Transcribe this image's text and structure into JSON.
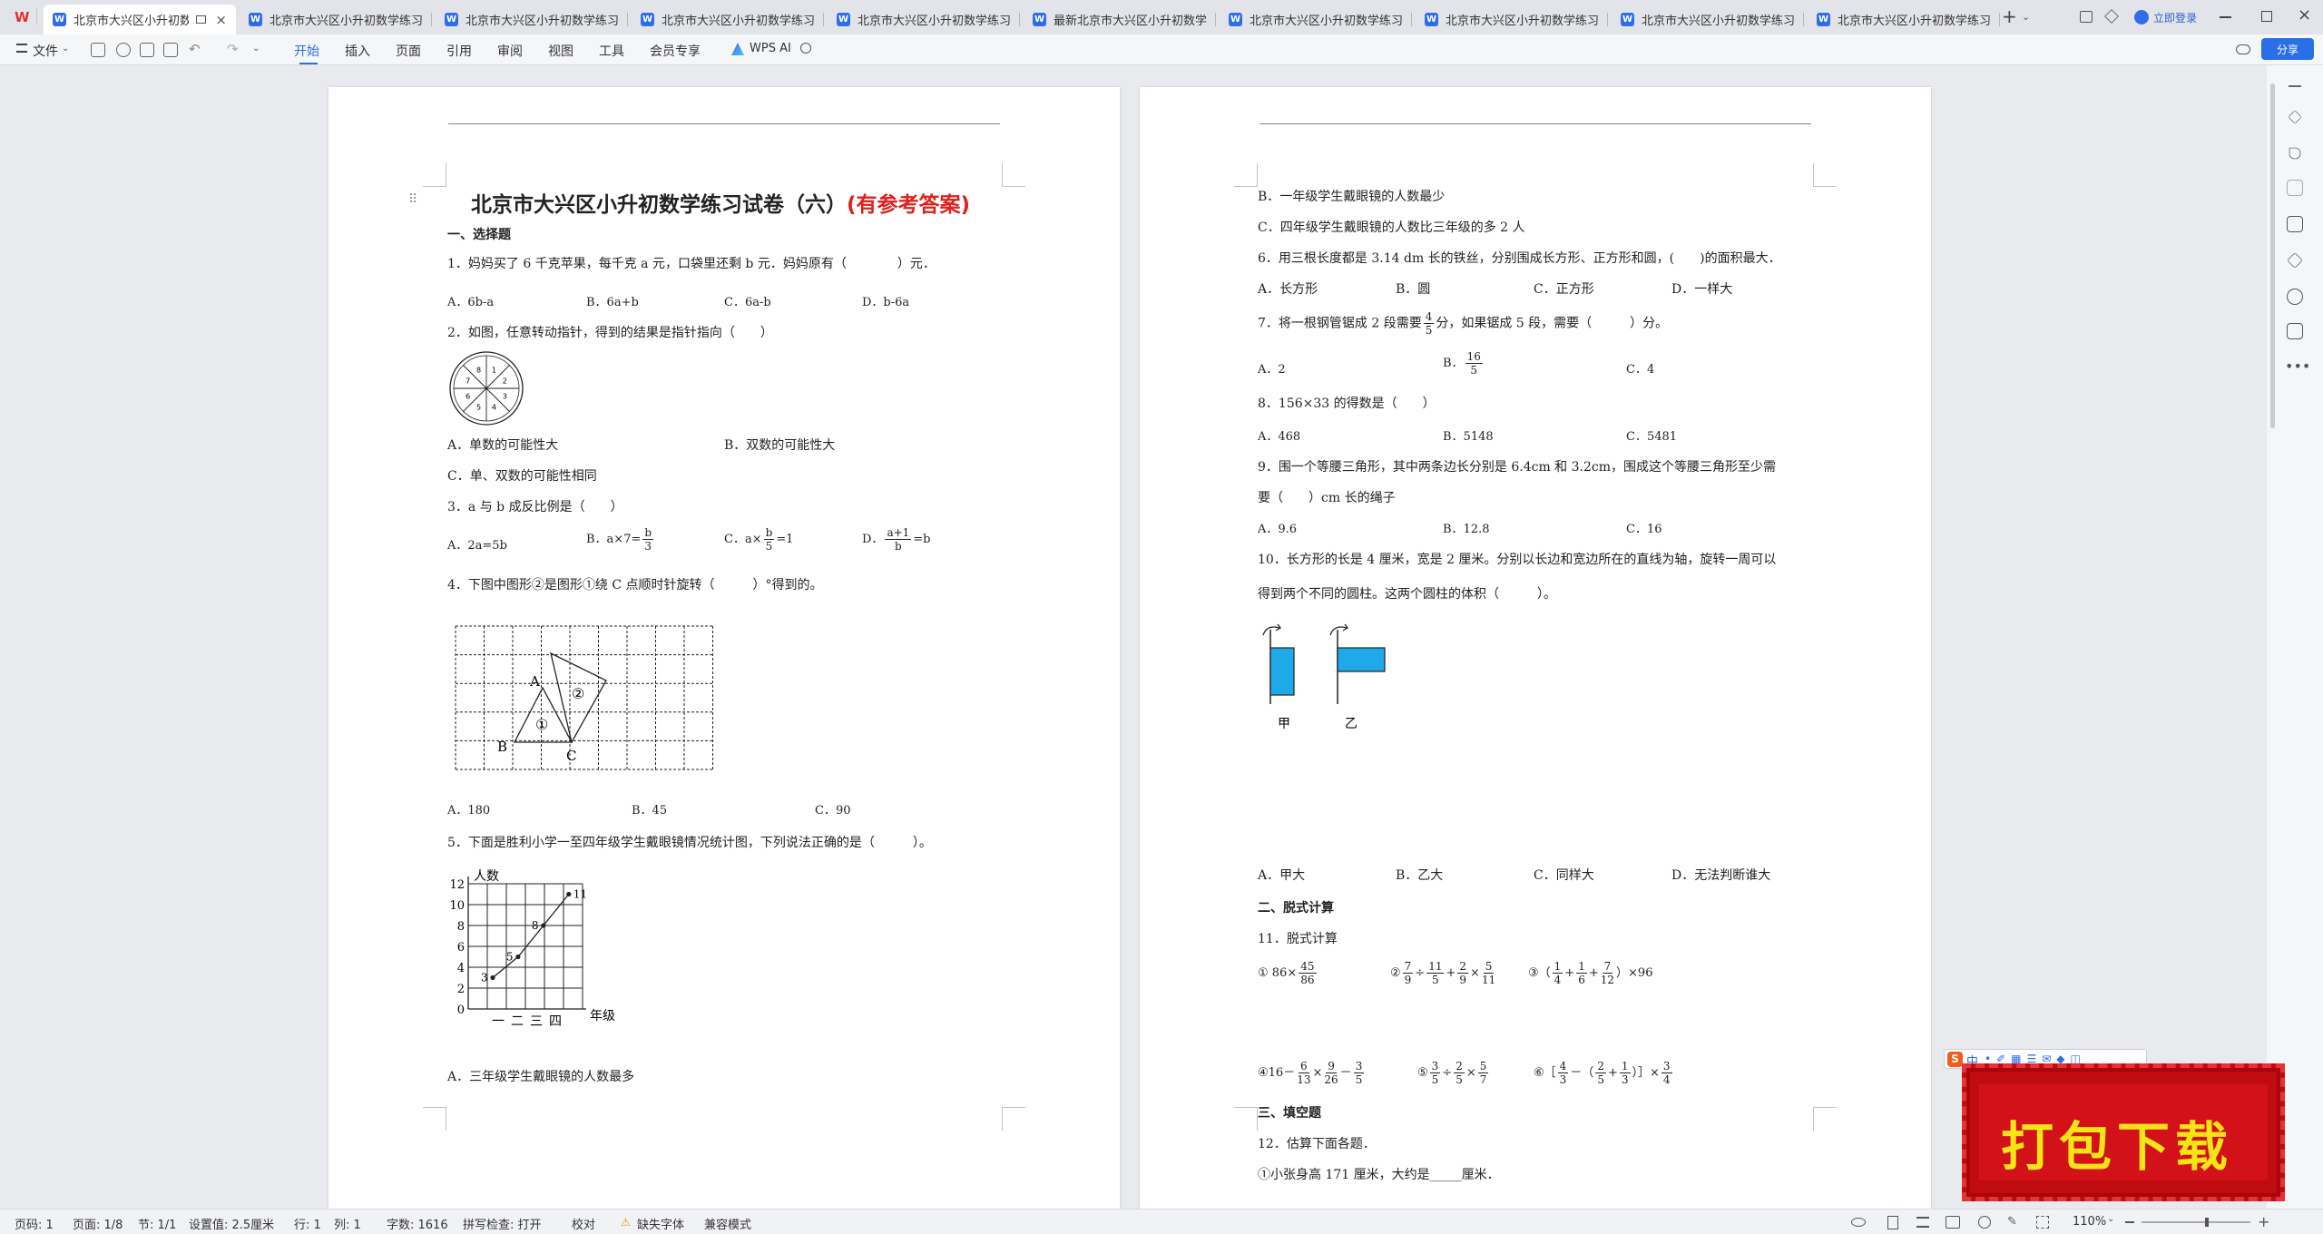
{
  "tabs": [
    {
      "label": "北京市大兴区小升初数学"
    },
    {
      "label": "北京市大兴区小升初数学练习试"
    },
    {
      "label": "北京市大兴区小升初数学练习试"
    },
    {
      "label": "北京市大兴区小升初数学练习试"
    },
    {
      "label": "北京市大兴区小升初数学练习试"
    },
    {
      "label": "最新北京市大兴区小升初数学练"
    },
    {
      "label": "北京市大兴区小升初数学练习试"
    },
    {
      "label": "北京市大兴区小升初数学练习试"
    },
    {
      "label": "北京市大兴区小升初数学练习试"
    },
    {
      "label": "北京市大兴区小升初数学练习试"
    }
  ],
  "header": {
    "login": "立即登录",
    "share": "分享"
  },
  "toolbar": {
    "file": "文件",
    "menus": [
      "开始",
      "插入",
      "页面",
      "引用",
      "审阅",
      "视图",
      "工具",
      "会员专享"
    ],
    "wps_ai": "WPS AI"
  },
  "doc": {
    "title_main": "北京市大兴区小升初数学练习试卷（六）",
    "title_red": "(有参考答案)",
    "sec1": "一、选择题",
    "q1": "1．妈妈买了 6 千克苹果，每千克 a 元，口袋里还剩 b 元．妈妈原有（　　　　）元．",
    "q1_opts": [
      "A．6b-a",
      "B．6a+b",
      "C．6a-b",
      "D．b-6a"
    ],
    "q2": "2．如图，任意转动指针，得到的结果是指针指向（　　）",
    "q2_opts": [
      "A．单数的可能性大",
      "B．双数的可能性大",
      "C．单、双数的可能性相同"
    ],
    "spinner_nums": [
      "8",
      "1",
      "2",
      "3",
      "4",
      "5",
      "6",
      "7"
    ],
    "q3": "3．a 与 b 成反比例是（　　）",
    "q3_a": "A．2a=5b",
    "q3_b_pre": "B．a×7=",
    "q3_b_frac": [
      "b",
      "3"
    ],
    "q3_c_pre": "C．a×",
    "q3_c_frac": [
      "b",
      "5"
    ],
    "q3_c_post": "=1",
    "q3_d_pre": "D．",
    "q3_d_frac": [
      "a+1",
      "b"
    ],
    "q3_d_post": "=b",
    "q4": "4．下图中图形②是图形①绕 C 点顺时针旋转（　　　）°得到的。",
    "q4_labels": [
      "A",
      "B",
      "C",
      "①",
      "②"
    ],
    "q4_opts": [
      "A．180",
      "B．45",
      "C．90"
    ],
    "q5": "5．下面是胜利小学一至四年级学生戴眼镜情况统计图，下列说法正确的是（　　　）。",
    "chart_ylabel": "人数",
    "chart_xlabel": "年级",
    "chart_y_ticks": [
      "12",
      "10",
      "8",
      "6",
      "4",
      "2",
      "0"
    ],
    "chart_x_ticks": [
      "一",
      "二",
      "三",
      "四"
    ],
    "chart_point_labels": [
      "3",
      "5",
      "8",
      "11"
    ],
    "q5_a": "A．三年级学生戴眼镜的人数最多",
    "q5_b": "B．一年级学生戴眼镜的人数最少",
    "q5_c": "C．四年级学生戴眼镜的人数比三年级的多 2 人",
    "q6": "6．用三根长度都是 3.14 dm 长的铁丝，分别围成长方形、正方形和圆，(　　)的面积最大．",
    "q6_opts": [
      "A．长方形",
      "B．圆",
      "C．正方形",
      "D．一样大"
    ],
    "q7_pre": "7．将一根钢管锯成 2 段需要",
    "q7_frac": [
      "4",
      "5"
    ],
    "q7_post": "分，如果锯成 5 段，需要（　　　）分。",
    "q7_a": "A．2",
    "q7_b_pre": "B．",
    "q7_b_frac": [
      "16",
      "5"
    ],
    "q7_c": "C．4",
    "q8": "8．156×33 的得数是（　　）",
    "q8_opts": [
      "A．468",
      "B．5148",
      "C．5481"
    ],
    "q9_l1": "9．围一个等腰三角形，其中两条边长分别是 6.4cm 和 3.2cm，围成这个等腰三角形至少需",
    "q9_l2": "要（　　）cm 长的绳子",
    "q9_opts": [
      "A．9.6",
      "B．12.8",
      "C．16"
    ],
    "q10_l1": "10．长方形的长是 4 厘米，宽是 2 厘米。分别以长边和宽边所在的直线为轴，旋转一周可以",
    "q10_l2": "得到两个不同的圆柱。这两个圆柱的体积（　　　）。",
    "q10_fig": [
      "甲",
      "乙"
    ],
    "q10_opts": [
      "A．甲大",
      "B．乙大",
      "C．同样大",
      "D．无法判断谁大"
    ],
    "sec2": "二、脱式计算",
    "q11": "11．脱式计算",
    "calc1_pre": "① 86×",
    "calc1_frac": [
      "45",
      "86"
    ],
    "calc2_pre": "②",
    "calc2_fracs": [
      [
        "7",
        "9"
      ],
      [
        "11",
        "5"
      ],
      [
        "2",
        "9"
      ],
      [
        "5",
        "11"
      ]
    ],
    "calc2_ops": [
      "÷",
      "+",
      "×"
    ],
    "calc3_pre": "③（",
    "calc3_fracs": [
      [
        "1",
        "4"
      ],
      [
        "1",
        "6"
      ],
      [
        "7",
        "12"
      ]
    ],
    "calc3_ops": [
      "+",
      "+"
    ],
    "calc3_post": "）×96",
    "calc4_pre": "④16－",
    "calc4_fracs": [
      [
        "6",
        "13"
      ],
      [
        "9",
        "26"
      ],
      [
        "3",
        "5"
      ]
    ],
    "calc4_ops": [
      "×",
      "－"
    ],
    "calc5_pre": "⑤",
    "calc5_fracs": [
      [
        "3",
        "5"
      ],
      [
        "2",
        "5"
      ],
      [
        "5",
        "7"
      ]
    ],
    "calc5_ops": [
      "÷",
      "×"
    ],
    "calc6_pre": "⑥［",
    "calc6_fracs": [
      [
        "4",
        "3"
      ],
      [
        "2",
        "5"
      ],
      [
        "1",
        "3"
      ],
      [
        "3",
        "4"
      ]
    ],
    "calc6_mid1": "－（",
    "calc6_op": "+",
    "calc6_mid2": "）］×",
    "sec3": "三、填空题",
    "q12": "12．估算下面各题．",
    "q12_1": "①小张身高 171 厘米，大约是_____厘米．"
  },
  "banner": {
    "text": "打包下载"
  },
  "ime": {
    "label": "中"
  },
  "status": {
    "page_no": "页码: 1",
    "pages": "页面: 1/8",
    "section": "节: 1/1",
    "setting": "设置值: 2.5厘米",
    "row": "行: 1",
    "col": "列: 1",
    "words": "字数: 1616",
    "spell": "拼写检查: 打开",
    "proof": "校对",
    "missing_font": "缺失字体",
    "compat": "兼容模式",
    "zoom": "110%"
  }
}
